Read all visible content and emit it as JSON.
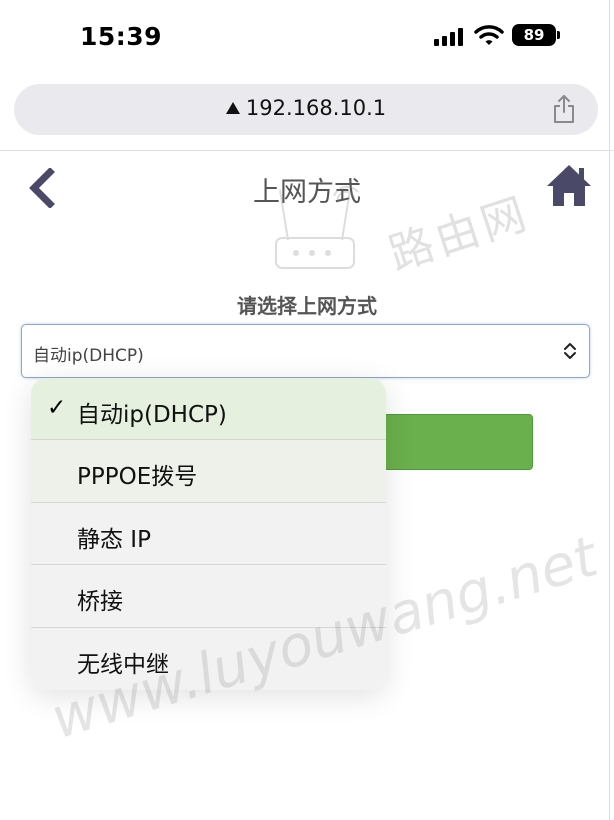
{
  "status_bar": {
    "time": "15:39",
    "battery": "89"
  },
  "url_bar": {
    "url": "192.168.10.1"
  },
  "page": {
    "title": "上网方式"
  },
  "form": {
    "label": "请选择上网方式",
    "selected_value": "自动ip(DHCP)"
  },
  "dropdown": {
    "options": [
      {
        "label": "自动ip(DHCP)",
        "checked": true
      },
      {
        "label": "PPPOE拨号",
        "checked": false
      },
      {
        "label": "静态 IP",
        "checked": false
      },
      {
        "label": "桥接",
        "checked": false
      },
      {
        "label": "无线中继",
        "checked": false
      }
    ],
    "check_mark": "✓"
  },
  "watermark": {
    "cn": "路由网",
    "url": "www.luyouwang.net"
  },
  "colors": {
    "accent_green": "#6ab04c",
    "select_border": "#8aa7cc"
  }
}
